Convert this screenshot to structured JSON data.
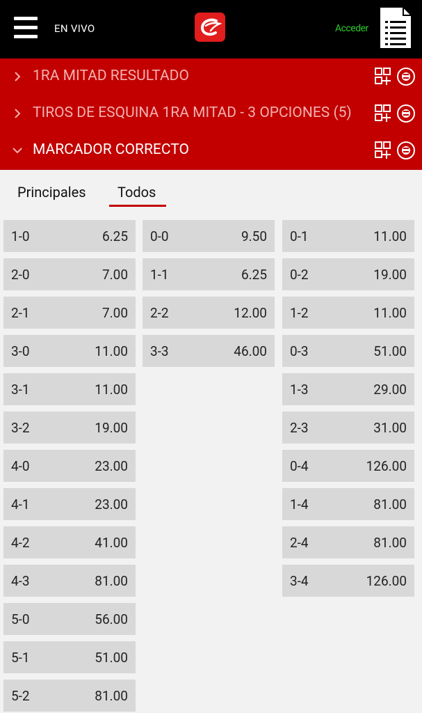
{
  "header": {
    "live_label": "EN VIVO",
    "login_label": "Acceder",
    "accent_color": "#c20000",
    "login_color": "#2ec52e",
    "icons": [
      "menu-icon",
      "brand-logo-icon",
      "betslip-document-icon"
    ]
  },
  "markets": [
    {
      "title": "1RA MITAD RESULTADO",
      "expanded": false
    },
    {
      "title": "TIROS DE ESQUINA 1RA MITAD - 3 OPCIONES (5)",
      "expanded": false
    },
    {
      "title": "MARCADOR CORRECTO",
      "expanded": true
    }
  ],
  "market_icons": [
    "add-grid-icon",
    "cash-refresh-icon"
  ],
  "tabs": [
    {
      "label": "Principales",
      "active": false
    },
    {
      "label": "Todos",
      "active": true
    }
  ],
  "columns": [
    [
      {
        "score": "1-0",
        "odds": "6.25"
      },
      {
        "score": "2-0",
        "odds": "7.00"
      },
      {
        "score": "2-1",
        "odds": "7.00"
      },
      {
        "score": "3-0",
        "odds": "11.00"
      },
      {
        "score": "3-1",
        "odds": "11.00"
      },
      {
        "score": "3-2",
        "odds": "19.00"
      },
      {
        "score": "4-0",
        "odds": "23.00"
      },
      {
        "score": "4-1",
        "odds": "23.00"
      },
      {
        "score": "4-2",
        "odds": "41.00"
      },
      {
        "score": "4-3",
        "odds": "81.00"
      },
      {
        "score": "5-0",
        "odds": "56.00"
      },
      {
        "score": "5-1",
        "odds": "51.00"
      },
      {
        "score": "5-2",
        "odds": "81.00"
      }
    ],
    [
      {
        "score": "0-0",
        "odds": "9.50"
      },
      {
        "score": "1-1",
        "odds": "6.25"
      },
      {
        "score": "2-2",
        "odds": "12.00"
      },
      {
        "score": "3-3",
        "odds": "46.00"
      }
    ],
    [
      {
        "score": "0-1",
        "odds": "11.00"
      },
      {
        "score": "0-2",
        "odds": "19.00"
      },
      {
        "score": "1-2",
        "odds": "11.00"
      },
      {
        "score": "0-3",
        "odds": "51.00"
      },
      {
        "score": "1-3",
        "odds": "29.00"
      },
      {
        "score": "2-3",
        "odds": "31.00"
      },
      {
        "score": "0-4",
        "odds": "126.00"
      },
      {
        "score": "1-4",
        "odds": "81.00"
      },
      {
        "score": "2-4",
        "odds": "81.00"
      },
      {
        "score": "3-4",
        "odds": "126.00"
      }
    ]
  ]
}
